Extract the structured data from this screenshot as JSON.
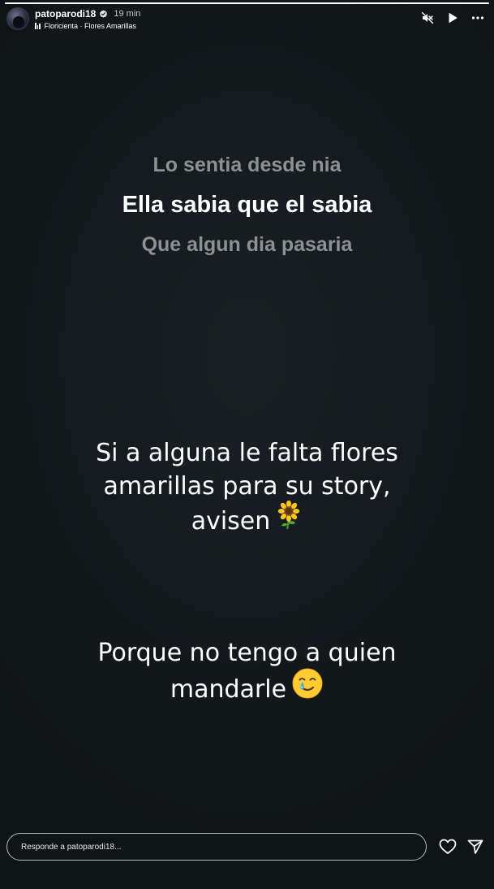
{
  "story": {
    "progress": 1.0
  },
  "header": {
    "username": "patoparodi18",
    "verified": true,
    "time": "19 min",
    "music": "Floricienta · Flores Amarillas"
  },
  "controls": {
    "muted": true,
    "playing": false
  },
  "lyrics": {
    "previous": "Lo sentia desde nia",
    "current": "Ella sabia que el sabia",
    "next": "Que algun dia pasaria"
  },
  "captions": [
    {
      "lines": [
        "Si a alguna le falta flores",
        "amarillas para su story,"
      ],
      "last_line": "avisen",
      "emoji": "sunflower"
    },
    {
      "lines": [
        "Porque no tengo a quien"
      ],
      "last_line": "mandarle",
      "emoji": "smiling-face-with-tear"
    }
  ],
  "footer": {
    "reply_placeholder": "Responde a patoparodi18..."
  },
  "colors": {
    "background": "#151b1e",
    "lyric_dim": "#8d9191",
    "text": "#ffffff"
  }
}
